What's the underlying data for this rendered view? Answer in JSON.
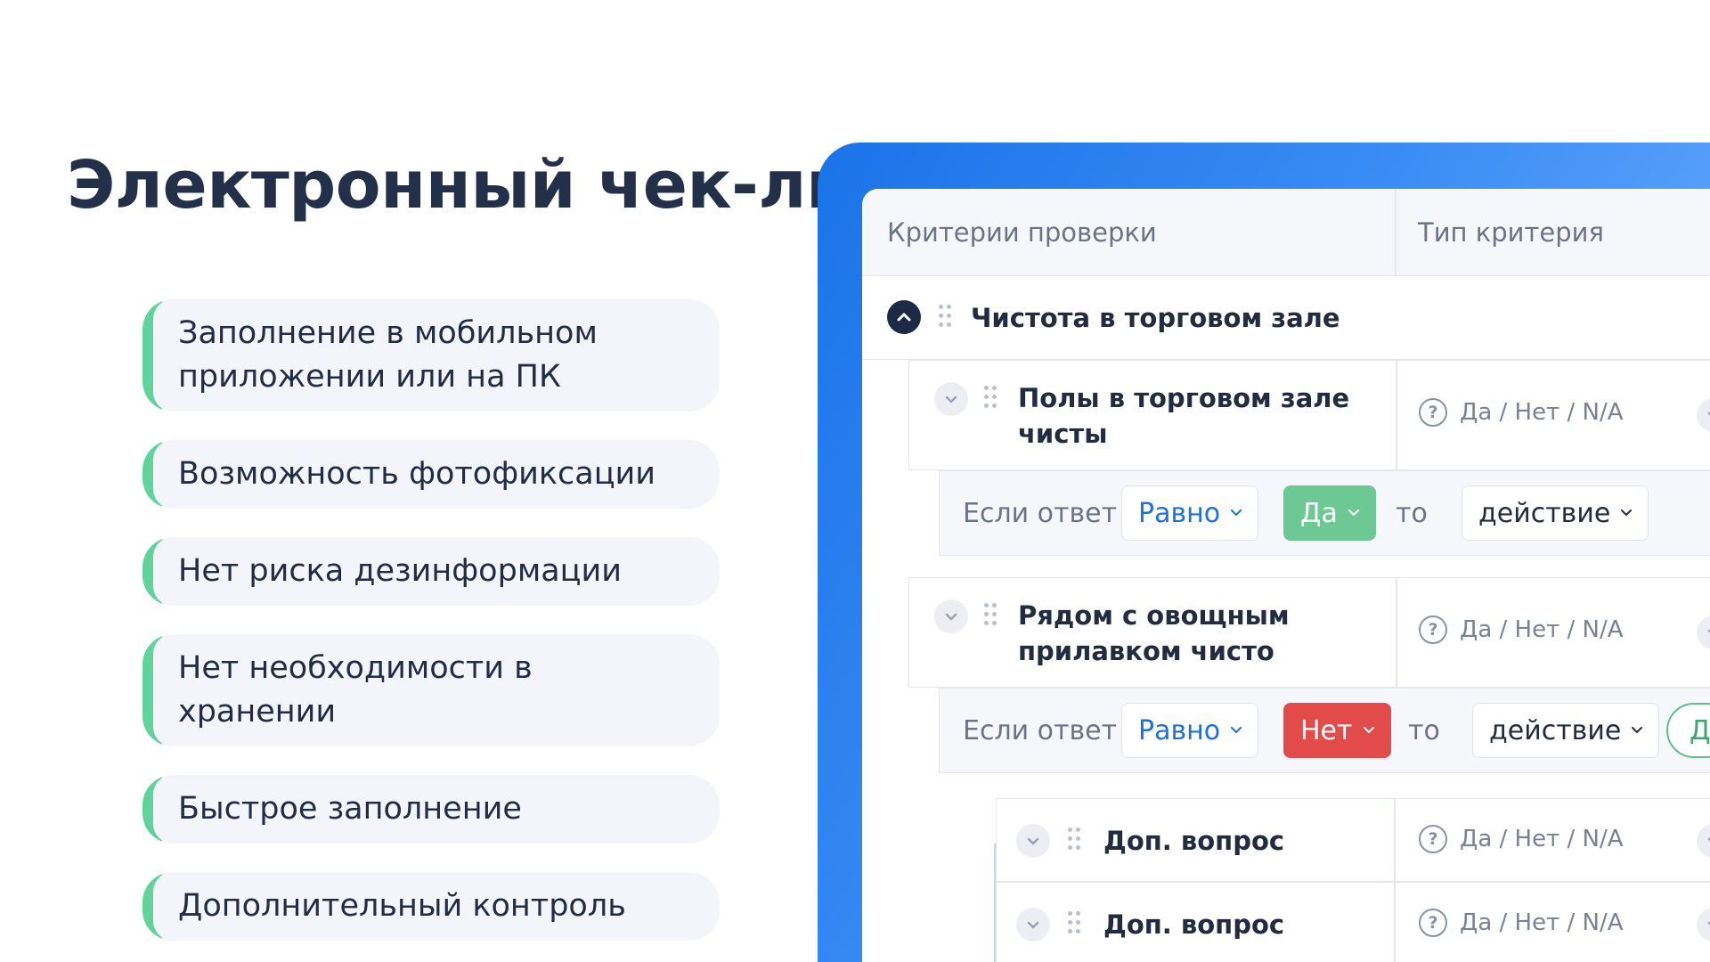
{
  "title": "Электронный чек-лист",
  "features": [
    "Заполнение в мобильном приложении или на ПК",
    "Возможность фотофиксации",
    "Нет риска дезинформации",
    "Нет необходимости в хранении",
    "Быстрое заполнение",
    "Дополнительный контроль"
  ],
  "table": {
    "headers": {
      "criteria": "Критерии проверки",
      "type": "Тип критерия"
    },
    "group_title": "Чистота в торговом зале",
    "questions": [
      {
        "text": "Полы в торговом зале чисты",
        "type": "Да / Нет / N/A"
      },
      {
        "text": "Рядом с овощным прилавком чисто",
        "type": "Да / Нет / N/A"
      },
      {
        "text": "Доп. вопрос",
        "type": "Да / Нет / N/A"
      },
      {
        "text": "Доп. вопрос",
        "type": "Да / Нет / N/A"
      }
    ],
    "conditions": [
      {
        "if_label": "Если ответ",
        "operator": "Равно",
        "answer": "Да",
        "then_label": "то",
        "action": "действие"
      },
      {
        "if_label": "Если ответ",
        "operator": "Равно",
        "answer": "Нет",
        "then_label": "то",
        "action": "действие",
        "extra": "Д"
      }
    ]
  },
  "colors": {
    "accent_green": "#5fd39a",
    "panel_blue": "#1a73e8",
    "answer_yes": "#6cc993",
    "answer_no": "#e34b4b"
  }
}
